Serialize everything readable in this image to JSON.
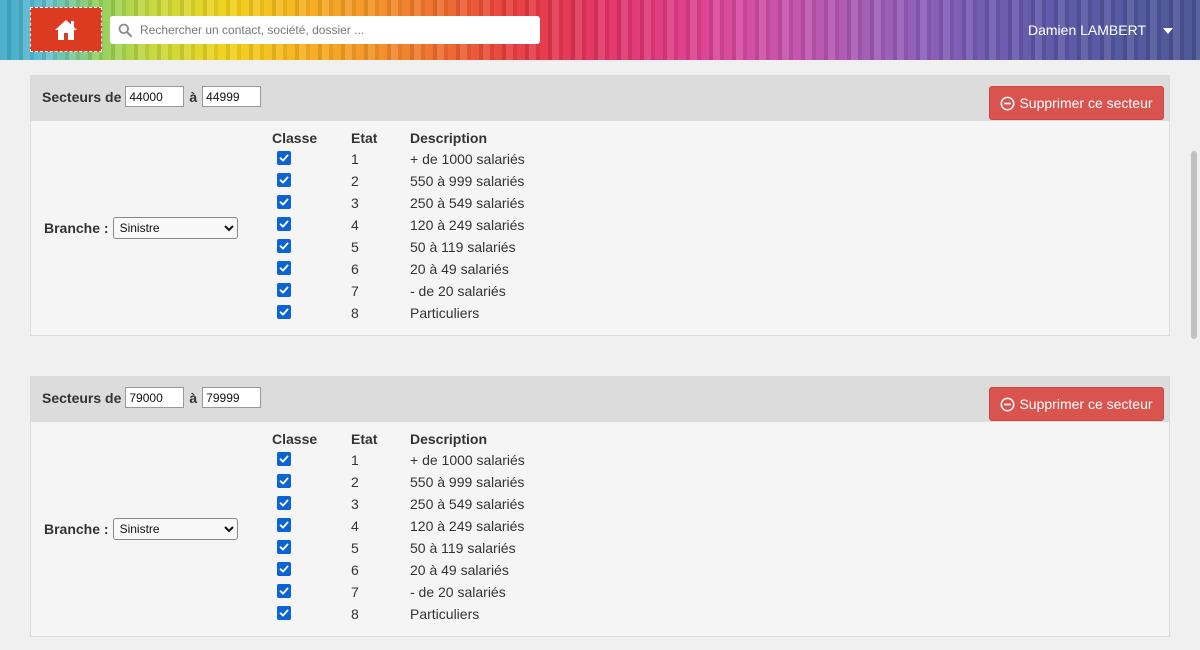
{
  "header": {
    "search_placeholder": "Rechercher un contact, société, dossier ...",
    "user_name": "Damien LAMBERT"
  },
  "columns": {
    "classe": "Classe",
    "etat": "Etat",
    "description": "Description"
  },
  "labels": {
    "secteurs_de": "Secteurs de",
    "a": "à",
    "branche": "Branche :",
    "delete": "Supprimer ce secteur"
  },
  "sectors": [
    {
      "from": "44000",
      "to": "44999",
      "branche": "Sinistre",
      "rows": [
        {
          "checked": true,
          "etat": "1",
          "description": "+ de 1000 salariés"
        },
        {
          "checked": true,
          "etat": "2",
          "description": "550 à 999 salariés"
        },
        {
          "checked": true,
          "etat": "3",
          "description": "250 à 549 salariés"
        },
        {
          "checked": true,
          "etat": "4",
          "description": "120 à 249 salariés"
        },
        {
          "checked": true,
          "etat": "5",
          "description": "50 à 119 salariés"
        },
        {
          "checked": true,
          "etat": "6",
          "description": "20 à 49 salariés"
        },
        {
          "checked": true,
          "etat": "7",
          "description": "- de 20 salariés"
        },
        {
          "checked": true,
          "etat": "8",
          "description": "Particuliers"
        }
      ]
    },
    {
      "from": "79000",
      "to": "79999",
      "branche": "Sinistre",
      "rows": [
        {
          "checked": true,
          "etat": "1",
          "description": "+ de 1000 salariés"
        },
        {
          "checked": true,
          "etat": "2",
          "description": "550 à 999 salariés"
        },
        {
          "checked": true,
          "etat": "3",
          "description": "250 à 549 salariés"
        },
        {
          "checked": true,
          "etat": "4",
          "description": "120 à 249 salariés"
        },
        {
          "checked": true,
          "etat": "5",
          "description": "50 à 119 salariés"
        },
        {
          "checked": true,
          "etat": "6",
          "description": "20 à 49 salariés"
        },
        {
          "checked": true,
          "etat": "7",
          "description": "- de 20 salariés"
        },
        {
          "checked": true,
          "etat": "8",
          "description": "Particuliers"
        }
      ]
    }
  ],
  "colors": {
    "accent_red": "#d9534f",
    "home_red": "#dd3a22",
    "checkbox_blue": "#0b63d4"
  },
  "icons": {
    "home": "home-icon",
    "search": "search-icon",
    "caret": "caret-down-icon",
    "minus": "minus-circle-icon",
    "check": "check-icon"
  }
}
